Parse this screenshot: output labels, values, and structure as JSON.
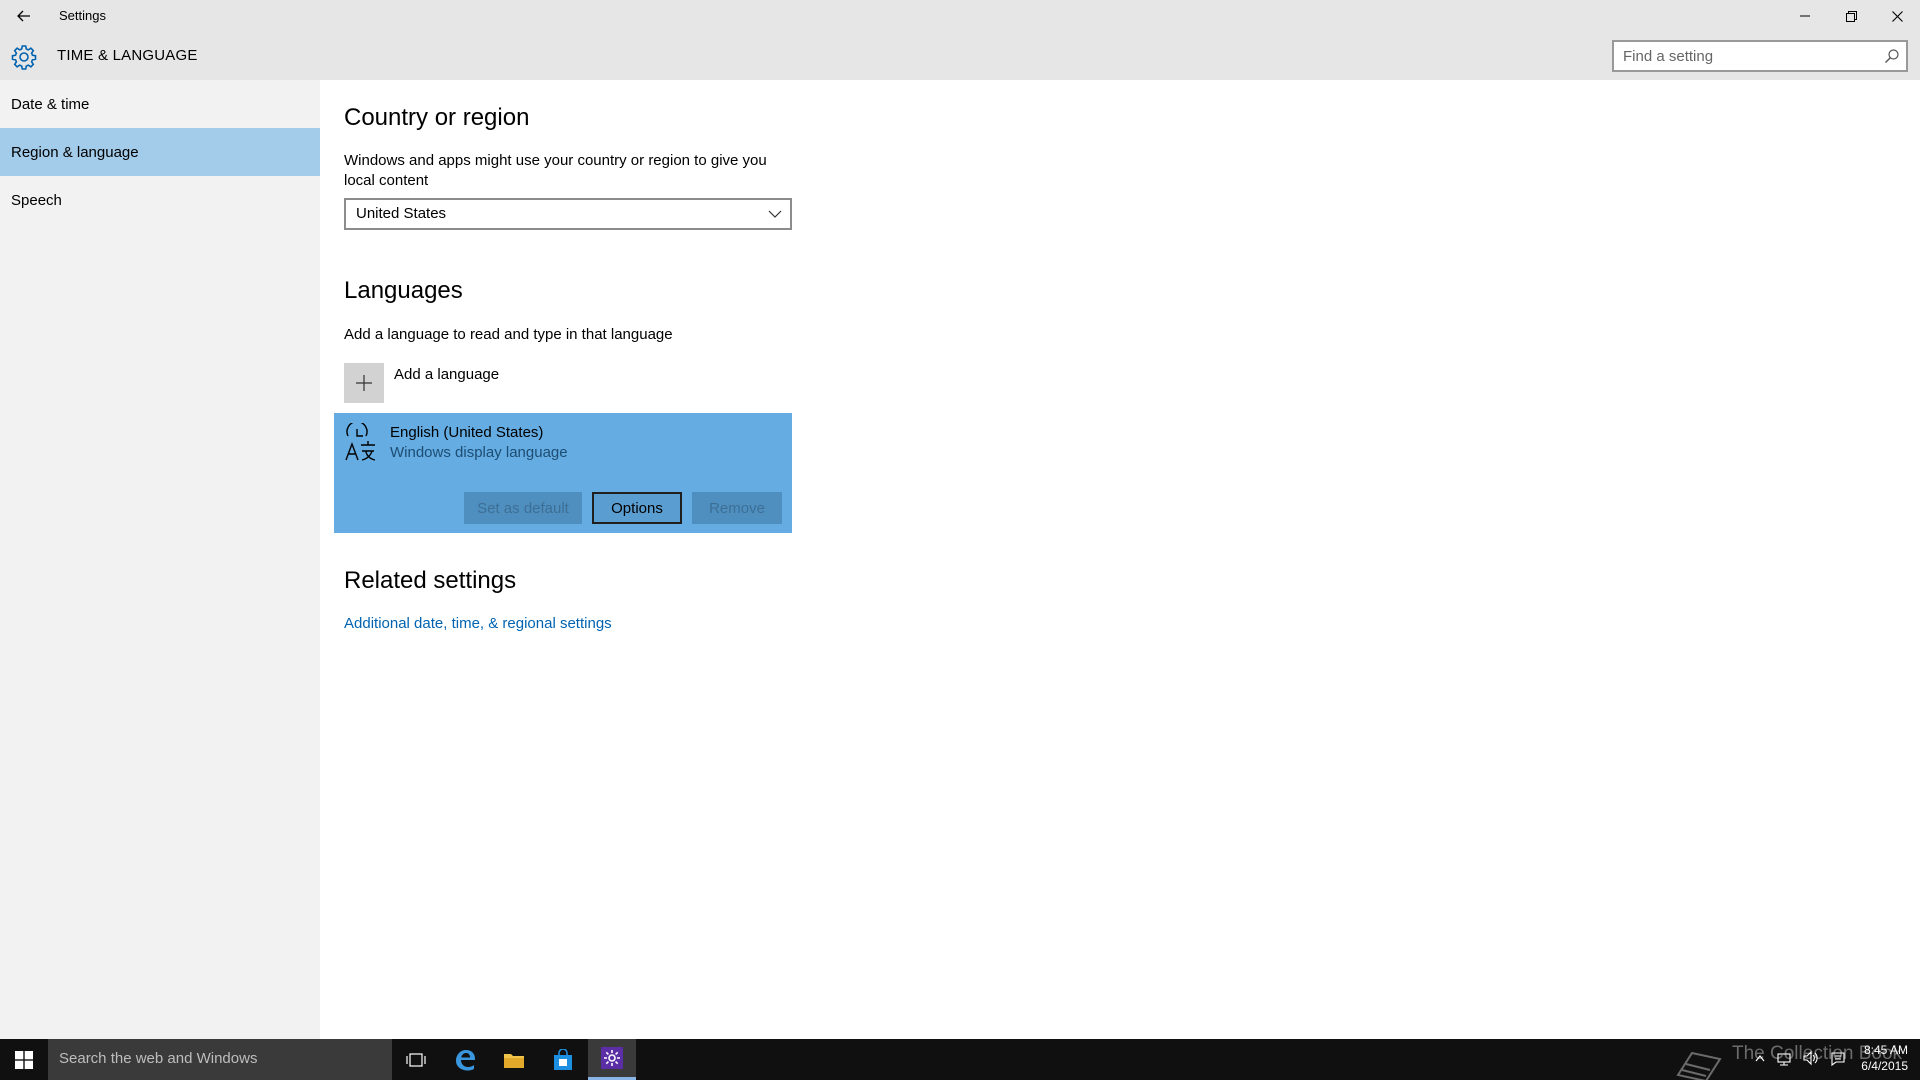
{
  "window": {
    "title": "Settings",
    "section_title": "TIME & LANGUAGE"
  },
  "search": {
    "placeholder": "Find a setting"
  },
  "sidebar": {
    "items": [
      {
        "label": "Date & time",
        "active": false
      },
      {
        "label": "Region & language",
        "active": true
      },
      {
        "label": "Speech",
        "active": false
      }
    ]
  },
  "country": {
    "heading": "Country or region",
    "description": "Windows and apps might use your country or region to give you local content",
    "selected": "United States"
  },
  "languages": {
    "heading": "Languages",
    "description": "Add a language to read and type in that language",
    "add_label": "Add a language",
    "items": [
      {
        "name": "English (United States)",
        "subtitle": "Windows display language",
        "buttons": {
          "set_default": "Set as default",
          "options": "Options",
          "remove": "Remove"
        }
      }
    ]
  },
  "related": {
    "heading": "Related settings",
    "link": "Additional date, time, & regional settings"
  },
  "taskbar": {
    "search_text": "Search the web and Windows",
    "time": "8:45 AM",
    "date": "6/4/2015",
    "watermark": "The Collection Book"
  },
  "colors": {
    "accent": "#0063b1",
    "selected_nav": "#a3cbea",
    "language_card": "#64ace2"
  }
}
